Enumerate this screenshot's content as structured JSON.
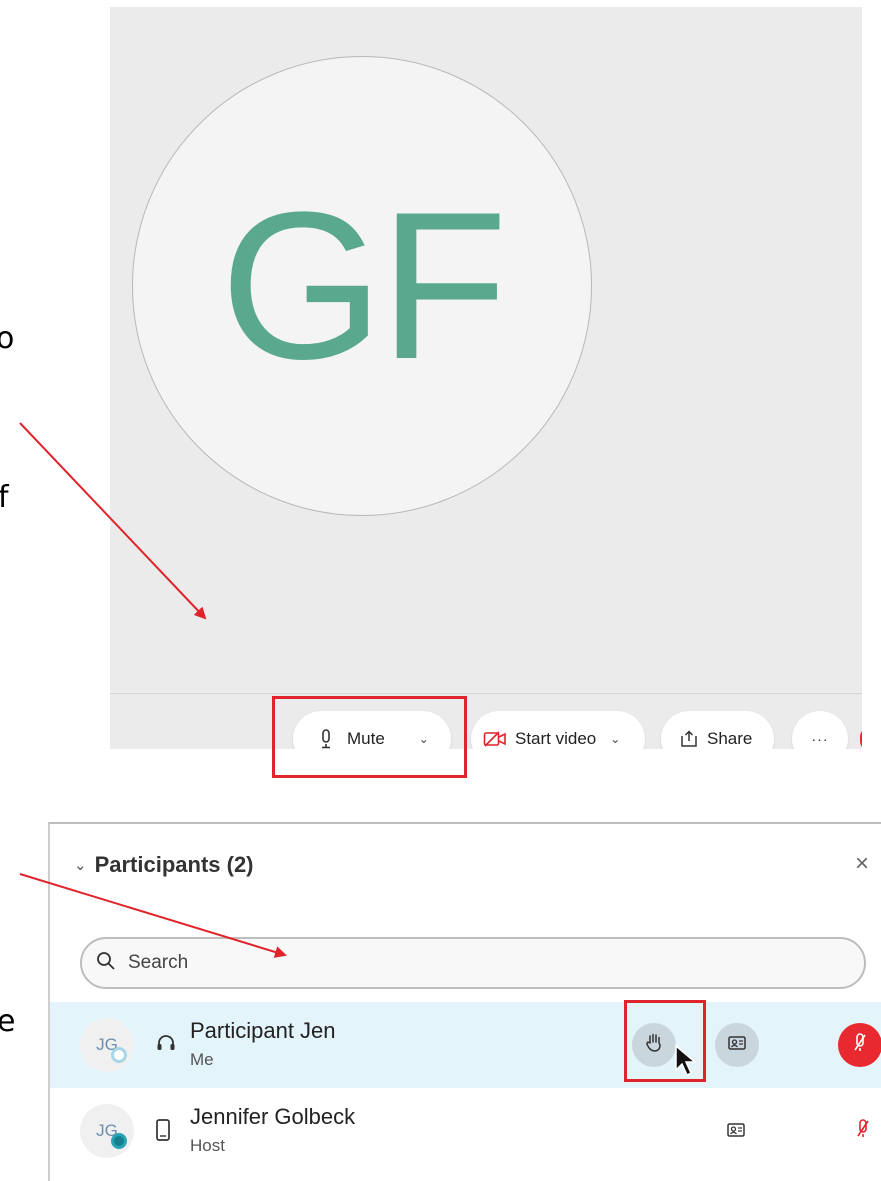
{
  "left_clipped_text": [
    "o",
    "f",
    "e"
  ],
  "avatar_large": {
    "initials": "GF",
    "color": "#5aa98f"
  },
  "controls": {
    "mute_label": "Mute",
    "start_video_label": "Start video",
    "share_label": "Share",
    "more_label": "···"
  },
  "participants_panel": {
    "title": "Participants (2)",
    "search_placeholder": "Search",
    "close_label": "×",
    "rows": [
      {
        "initials": "JG",
        "name": "Participant Jen",
        "subtitle": "Me",
        "device_icon": "headset-icon",
        "status_color": "#a9d6e6"
      },
      {
        "initials": "JG",
        "name": "Jennifer Golbeck",
        "subtitle": "Host",
        "device_icon": "phone-icon",
        "status_color": "#14808f"
      }
    ]
  },
  "colors": {
    "highlight": "#e0242b",
    "mute_active": "#e8292f",
    "row_selected": "#e4f4fb"
  }
}
